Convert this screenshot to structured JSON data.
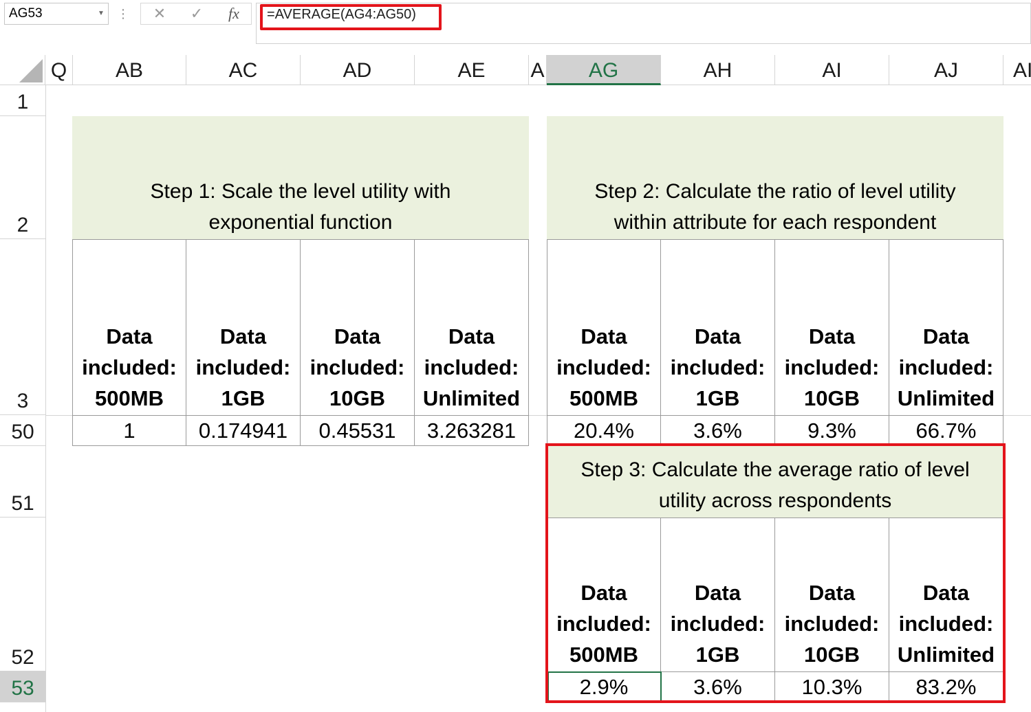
{
  "formula_bar": {
    "name_box": "AG53",
    "cancel_symbol": "✕",
    "enter_symbol": "✓",
    "fx_symbol": "fx",
    "formula": "=AVERAGE(AG4:AG50)"
  },
  "column_headers": [
    "Q",
    "AB",
    "AC",
    "AD",
    "AE",
    "A",
    "AG",
    "AH",
    "AI",
    "AJ",
    "AI"
  ],
  "row_headers": [
    "1",
    "2",
    "3",
    "50",
    "51",
    "52",
    "53"
  ],
  "selected_cell": "AG53",
  "step1": {
    "title_line1": "Step 1: Scale the level utility with",
    "title_line2": "exponential function",
    "headers": [
      [
        "Data",
        "included:",
        "500MB"
      ],
      [
        "Data",
        "included:",
        "1GB"
      ],
      [
        "Data",
        "included:",
        "10GB"
      ],
      [
        "Data",
        "included:",
        "Unlimited"
      ]
    ],
    "row50": [
      "1",
      "0.174941",
      "0.45531",
      "3.263281"
    ]
  },
  "step2": {
    "title_line1": "Step 2: Calculate the ratio of level utility",
    "title_line2": "within attribute for each respondent",
    "headers": [
      [
        "Data",
        "included:",
        "500MB"
      ],
      [
        "Data",
        "included:",
        "1GB"
      ],
      [
        "Data",
        "included:",
        "10GB"
      ],
      [
        "Data",
        "included:",
        "Unlimited"
      ]
    ],
    "row50": [
      "20.4%",
      "3.6%",
      "9.3%",
      "66.7%"
    ]
  },
  "step3": {
    "title_line1": "Step 3: Calculate the average ratio of level",
    "title_line2": "utility across respondents",
    "headers": [
      [
        "Data",
        "included:",
        "500MB"
      ],
      [
        "Data",
        "included:",
        "1GB"
      ],
      [
        "Data",
        "included:",
        "10GB"
      ],
      [
        "Data",
        "included:",
        "Unlimited"
      ]
    ],
    "row53": [
      "2.9%",
      "3.6%",
      "10.3%",
      "83.2%"
    ]
  },
  "colors": {
    "title_fill": "#ebf1de",
    "highlight_red": "#e3141b",
    "excel_green": "#217346"
  }
}
